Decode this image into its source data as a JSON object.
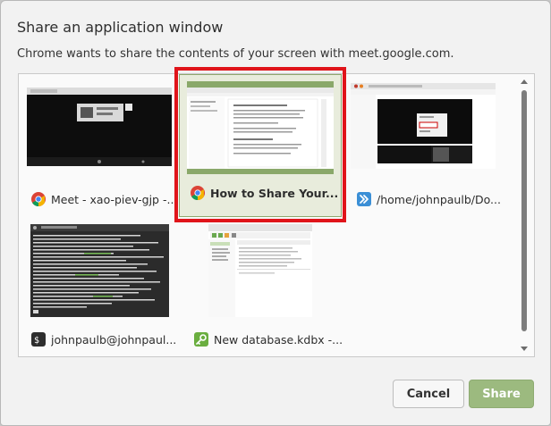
{
  "dialog": {
    "title": "Share an application window",
    "subtitle": "Chrome wants to share the contents of your screen with meet.google.com."
  },
  "windows": [
    {
      "label": "Meet - xao-piev-gjp -...",
      "icon": "chrome-icon",
      "selected": false
    },
    {
      "label": "How to Share Your...",
      "icon": "chrome-icon",
      "selected": true
    },
    {
      "label": "/home/johnpaulb/Do...",
      "icon": "file-manager-icon",
      "selected": false
    },
    {
      "label": "johnpaulb@johnpaul...",
      "icon": "terminal-icon",
      "selected": false
    },
    {
      "label": "New database.kdbx -...",
      "icon": "keepassxc-icon",
      "selected": false
    }
  ],
  "buttons": {
    "cancel": "Cancel",
    "share": "Share"
  },
  "colors": {
    "accent": "#9cba7f",
    "selection_border": "#e0141a"
  }
}
